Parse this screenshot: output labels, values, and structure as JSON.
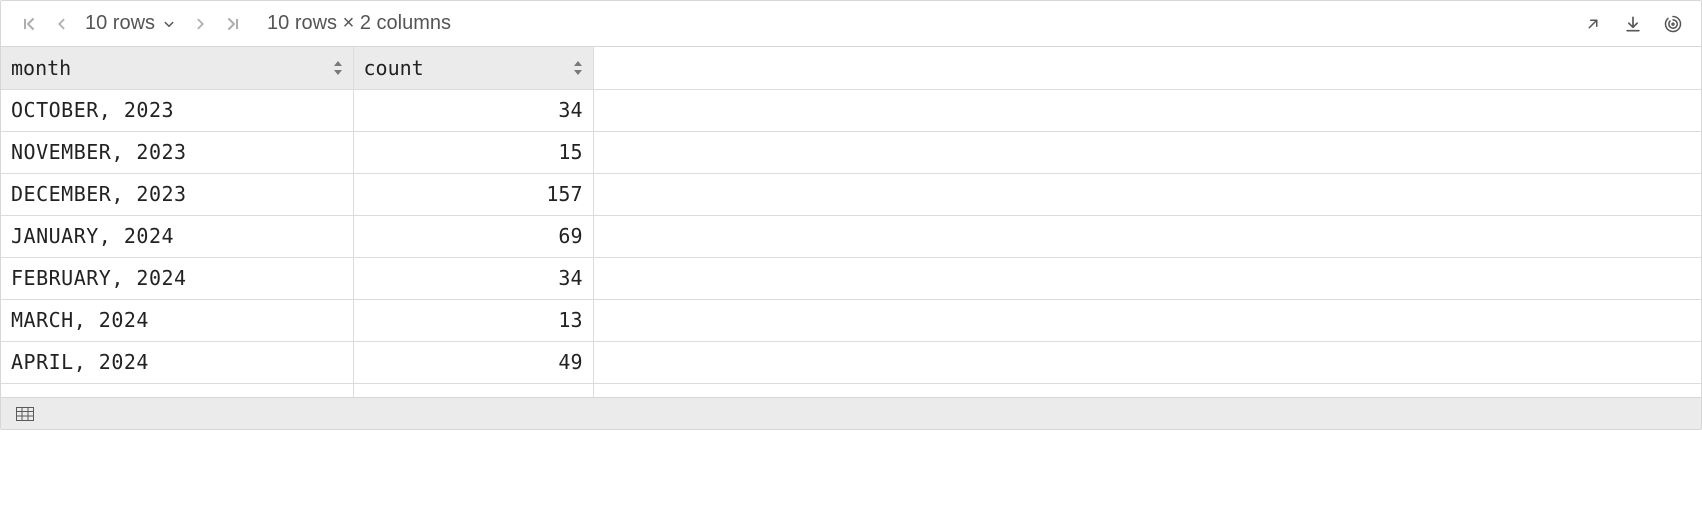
{
  "toolbar": {
    "page_size_label": "10 rows",
    "summary": "10 rows × 2 columns"
  },
  "columns": [
    {
      "name": "month"
    },
    {
      "name": "count"
    }
  ],
  "rows": [
    {
      "month": "OCTOBER, 2023",
      "count": 34
    },
    {
      "month": "NOVEMBER, 2023",
      "count": 15
    },
    {
      "month": "DECEMBER, 2023",
      "count": 157
    },
    {
      "month": "JANUARY, 2024",
      "count": 69
    },
    {
      "month": "FEBRUARY, 2024",
      "count": 34
    },
    {
      "month": "MARCH, 2024",
      "count": 13
    },
    {
      "month": "APRIL, 2024",
      "count": 49
    }
  ]
}
